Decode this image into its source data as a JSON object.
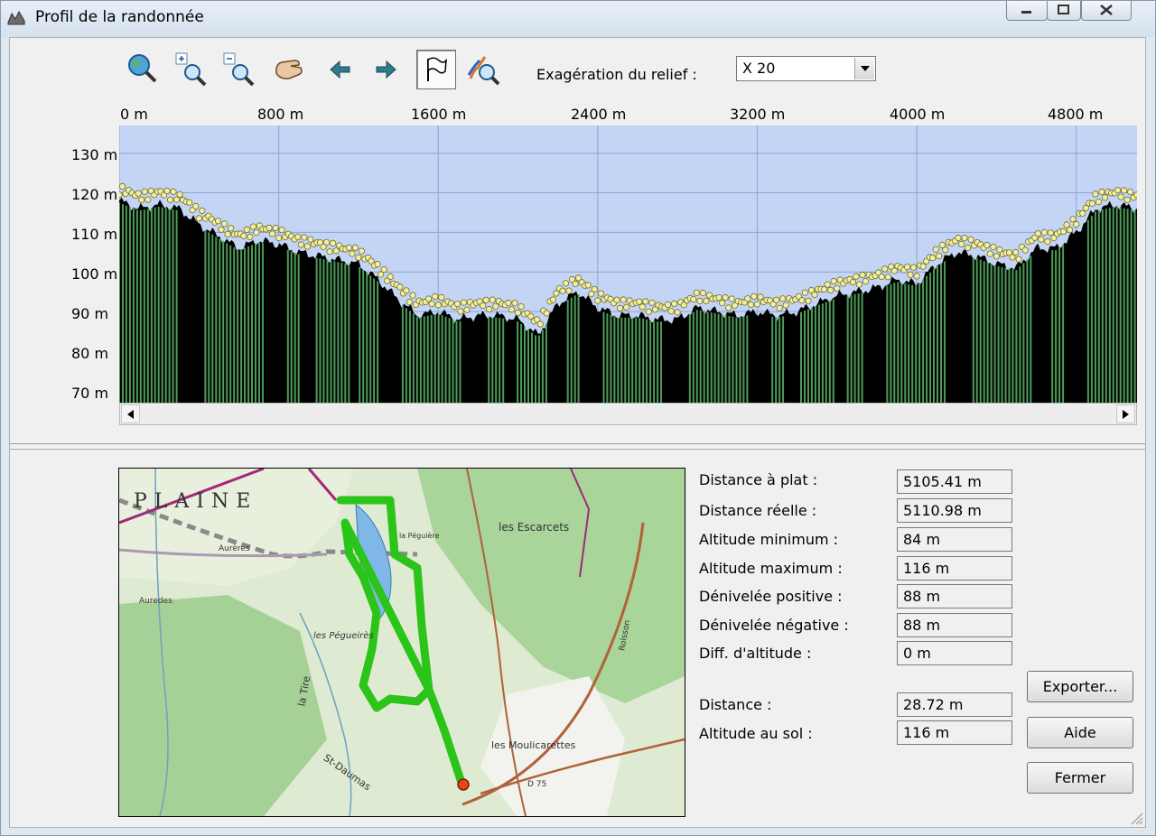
{
  "window": {
    "title": "Profil de la randonnée"
  },
  "toolbar": {
    "exaggeration_label": "Exagération du relief :",
    "exaggeration_value": "X 20"
  },
  "profile": {
    "x_ticks": [
      "0 m",
      "800 m",
      "1600 m",
      "2400 m",
      "3200 m",
      "4000 m",
      "4800 m"
    ],
    "y_ticks": [
      "130 m",
      "120 m",
      "110 m",
      "100 m",
      "90 m",
      "80 m",
      "70 m"
    ],
    "colors": {
      "sky": "#c4d4f4",
      "ground": "#000000",
      "bars": "#4e9b58",
      "points": "#f4ef9a",
      "grid": "#8fa3d2"
    }
  },
  "chart_data": {
    "type": "area",
    "title": "",
    "xlabel": "",
    "ylabel": "",
    "xlim": [
      0,
      5105
    ],
    "ylim": [
      67,
      137
    ],
    "x": [
      0,
      100,
      200,
      300,
      400,
      500,
      600,
      700,
      800,
      900,
      1000,
      1100,
      1200,
      1300,
      1400,
      1500,
      1600,
      1700,
      1800,
      1900,
      2000,
      2100,
      2200,
      2300,
      2400,
      2500,
      2600,
      2700,
      2800,
      2900,
      3000,
      3100,
      3200,
      3300,
      3400,
      3500,
      3600,
      3700,
      3800,
      3900,
      4000,
      4100,
      4200,
      4300,
      4400,
      4500,
      4600,
      4700,
      4800,
      4900,
      5000,
      5105
    ],
    "series": [
      {
        "values": [
          118,
          116,
          117,
          116,
          112,
          109,
          106,
          108,
          107,
          105,
          104,
          103,
          102,
          98,
          93,
          89,
          90,
          88,
          89,
          89,
          88,
          84,
          92,
          95,
          91,
          89,
          89,
          88,
          88,
          91,
          90,
          89,
          90,
          89,
          90,
          92,
          94,
          95,
          96,
          98,
          97,
          102,
          105,
          104,
          102,
          101,
          106,
          106,
          110,
          116,
          117,
          116
        ]
      }
    ]
  },
  "map": {
    "labels": [
      "PLAINE",
      "Aurères",
      "les Escarcets",
      "les Pégueirès",
      "la Tire",
      "les Moulicarettes",
      "St-Daumas",
      "D 75",
      "Auredes",
      "la Péguière",
      "Rolsson"
    ]
  },
  "stats": [
    {
      "label": "Distance à plat :",
      "value": "5105.41 m"
    },
    {
      "label": "Distance réelle :",
      "value": "5110.98 m"
    },
    {
      "label": "Altitude minimum :",
      "value": "84 m"
    },
    {
      "label": "Altitude maximum :",
      "value": "116 m"
    },
    {
      "label": "Dénivelée positive :",
      "value": "88 m"
    },
    {
      "label": "Dénivelée négative :",
      "value": "88 m"
    },
    {
      "label": "Diff. d'altitude :",
      "value": "0 m"
    }
  ],
  "cursor": [
    {
      "label": "Distance :",
      "value": "28.72 m"
    },
    {
      "label": "Altitude au sol :",
      "value": "116 m"
    }
  ],
  "buttons": {
    "export": "Exporter...",
    "help": "Aide",
    "close": "Fermer"
  }
}
